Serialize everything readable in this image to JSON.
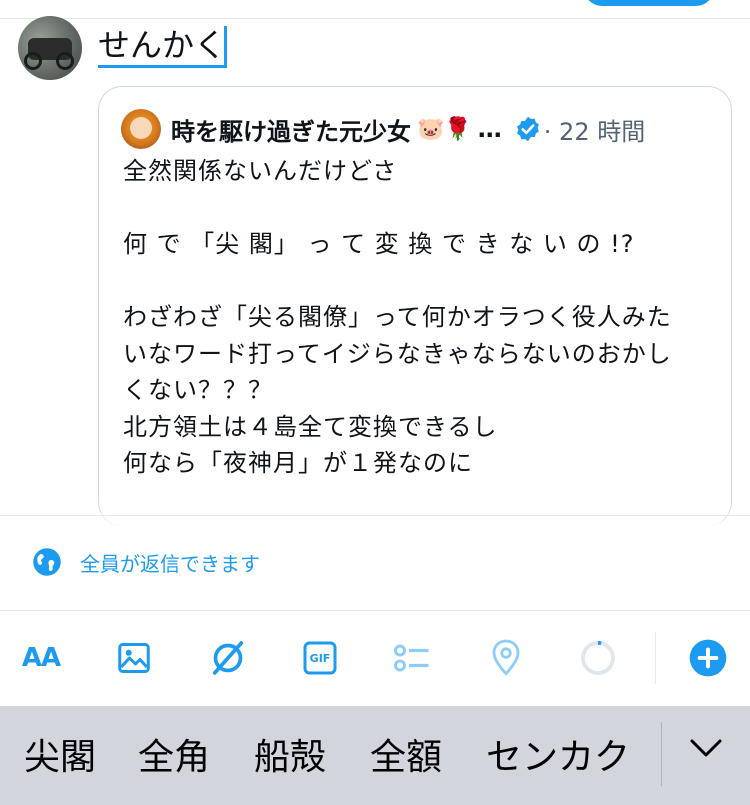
{
  "composer": {
    "text": "せんかく"
  },
  "quoted_post": {
    "author_name": "時を駆け過ぎた元少女",
    "author_emoji": "🐷🌹",
    "ellipsis": "…",
    "time": "· 22 時間",
    "verified": true,
    "lines": [
      "全然関係ないんだけどさ",
      "",
      "何 で 「尖 閣」 っ て 変 換 で き な い の !?",
      "",
      "わざわざ「尖る閣僚」って何かオラつく役人みた",
      "いなワード打ってイジらなきゃならないのおかし",
      "くない？？？",
      "北方領土は４島全て変換できるし",
      "何なら「夜神月」が１発なのに"
    ]
  },
  "reply_setting": {
    "label": "全員が返信できます",
    "icon": "globe-icon"
  },
  "toolbar": {
    "text_format_label": "AA",
    "icons": [
      "text-size-icon",
      "image-icon",
      "no-sign-icon",
      "gif-icon",
      "poll-icon",
      "location-icon",
      "character-count-ring",
      "add-icon"
    ],
    "gif_label": "GIF"
  },
  "keyboard_suggestions": {
    "candidates": [
      "尖閣",
      "全角",
      "船殻",
      "全額",
      "センカク"
    ],
    "expand_icon": "chevron-down-icon"
  },
  "colors": {
    "accent": "#1d9bf0",
    "text": "#0f1419",
    "muted": "#536471",
    "border": "#cfd9de",
    "suggestion_bar": "#d2d5db"
  }
}
